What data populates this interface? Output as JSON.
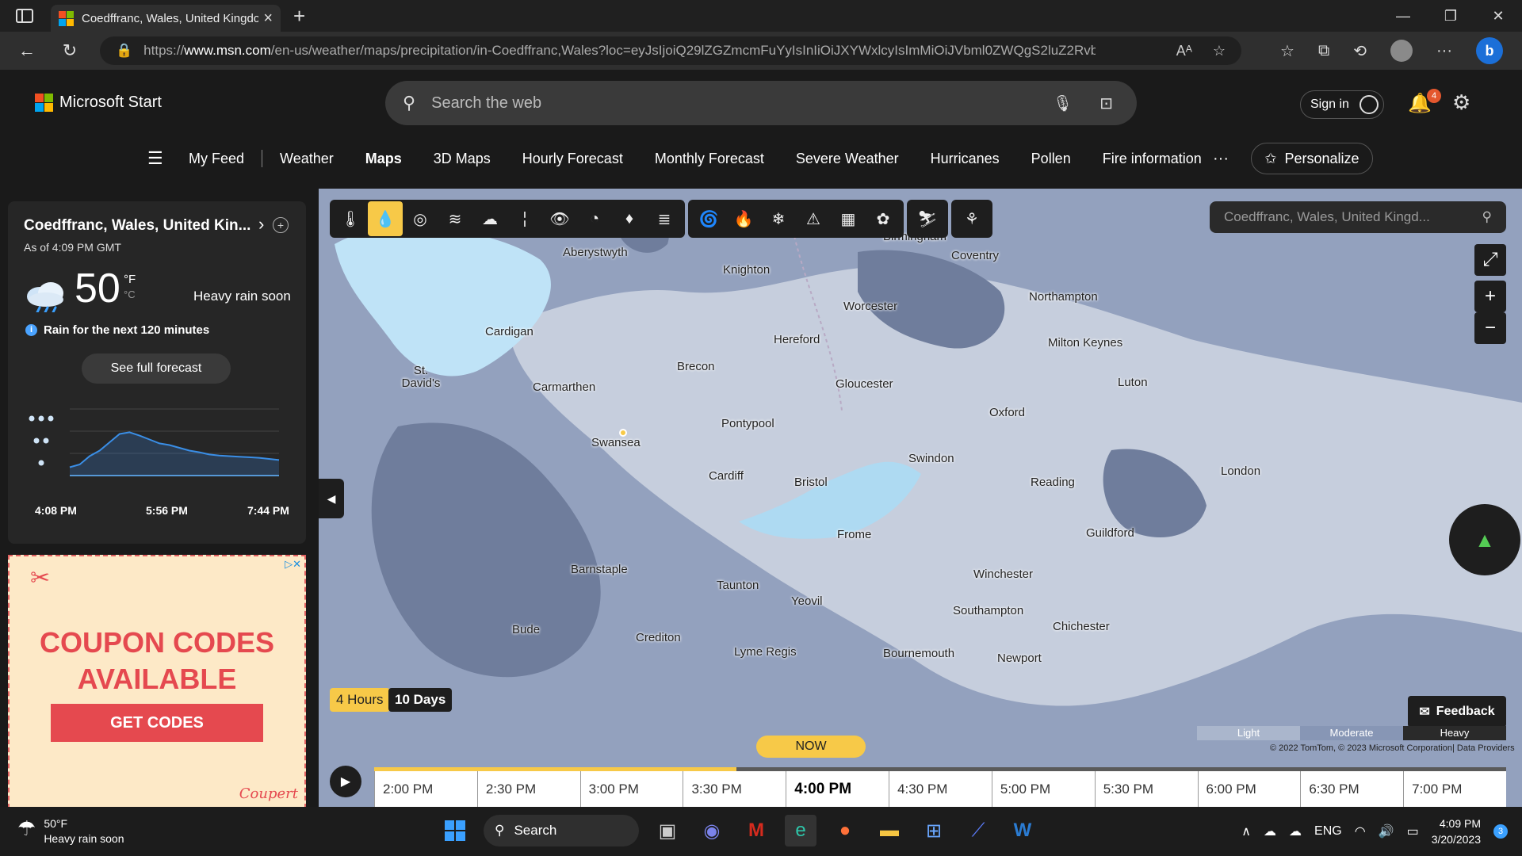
{
  "browser": {
    "tab_title": "Coedffranc, Wales, United Kingdo",
    "url_prefix": "https://",
    "url_domain": "www.msn.com",
    "url_rest": "/en-us/weather/maps/precipitation/in-Coedffranc,Wales?loc=eyJsIjoiQ29lZGZmcmFuYyIsInIiOiJXYWxlcyIsImMiOiJVbml0ZWQgS2luZ2RvbSIsIm..."
  },
  "header": {
    "brand": "Microsoft Start",
    "search_placeholder": "Search the web",
    "signin": "Sign in",
    "notifications": "4"
  },
  "nav": {
    "items": [
      "My Feed",
      "Weather",
      "Maps",
      "3D Maps",
      "Hourly Forecast",
      "Monthly Forecast",
      "Severe Weather",
      "Hurricanes",
      "Pollen",
      "Fire information"
    ],
    "more": "···",
    "personalize": "Personalize"
  },
  "weather_card": {
    "location": "Coedffranc, Wales, United Kin...",
    "as_of": "As of 4:09 PM GMT",
    "temperature": "50",
    "unit_f": "°F",
    "unit_c": "°C",
    "condition": "Heavy rain soon",
    "rain_note": "Rain for the next 120 minutes",
    "forecast_button": "See full forecast",
    "time_labels": [
      "4:08 PM",
      "5:56 PM",
      "7:44 PM"
    ],
    "precip_series": [
      0.15,
      0.2,
      0.35,
      0.45,
      0.6,
      0.75,
      0.78,
      0.72,
      0.65,
      0.58,
      0.55,
      0.5,
      0.45,
      0.42,
      0.38,
      0.36,
      0.35,
      0.34,
      0.33,
      0.32,
      0.3,
      0.28
    ]
  },
  "ad": {
    "title_line1": "COUPON CODES",
    "title_line2": "AVAILABLE",
    "button": "GET CODES",
    "brand": "Coupert"
  },
  "map": {
    "search_placeholder": "Coedffranc, Wales, United Kingd...",
    "labels": [
      "Aberystwyth",
      "Knighton",
      "Birmingham",
      "Coventry",
      "Northampton",
      "Worcester",
      "Cardigan",
      "Hereford",
      "Milton Keynes",
      "Brecon",
      "St. David's",
      "Carmarthen",
      "Gloucester",
      "Luton",
      "Oxford",
      "Pontypool",
      "Swansea",
      "Swindon",
      "Cardiff",
      "Bristol",
      "Reading",
      "London",
      "Frome",
      "Guildford",
      "Barnstaple",
      "Winchester",
      "Taunton",
      "Yeovil",
      "Southampton",
      "Bude",
      "Chichester",
      "Crediton",
      "Lyme Regis",
      "Bournemouth",
      "Newport"
    ],
    "mode_4h": "4 Hours",
    "mode_10d": "10 Days",
    "feedback": "Feedback",
    "legend": [
      "Light",
      "Moderate",
      "Heavy"
    ],
    "copyright": "© 2022 TomTom, © 2023 Microsoft Corporation| Data Providers",
    "now": "NOW",
    "timeline": [
      "2:00 PM",
      "2:30 PM",
      "3:00 PM",
      "3:30 PM",
      "4:00 PM",
      "4:30 PM",
      "5:00 PM",
      "5:30 PM",
      "6:00 PM",
      "6:30 PM",
      "7:00 PM"
    ],
    "progress": 0.32
  },
  "taskbar": {
    "weather_temp": "50°F",
    "weather_cond": "Heavy rain soon",
    "search": "Search",
    "lang": "ENG",
    "time": "4:09 PM",
    "date": "3/20/2023",
    "notif_count": "3"
  },
  "colors": {
    "accent": "#f7c948",
    "rain_light": "#aab6cc",
    "rain_moderate": "#8796b5",
    "rain_heavy": "#5d6c8c"
  }
}
